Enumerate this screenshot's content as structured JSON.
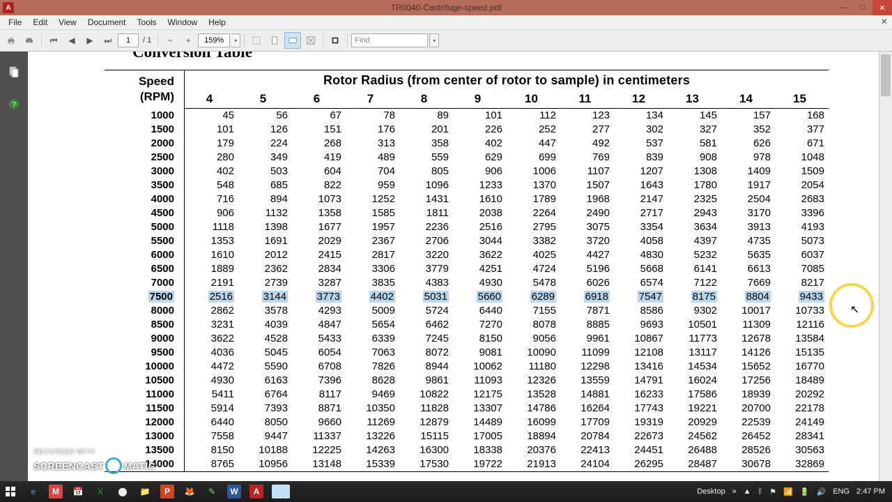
{
  "window": {
    "title": "TR0040-Centrifuge-speed.pdf",
    "app_glyph": "A"
  },
  "menu": [
    "File",
    "Edit",
    "View",
    "Document",
    "Tools",
    "Window",
    "Help"
  ],
  "toolbar": {
    "page_current": "1",
    "page_total": "/ 1",
    "zoom": "159%",
    "find_placeholder": "Find"
  },
  "doc": {
    "cut_title": "Conversion Table",
    "rpm_header_l1": "Speed",
    "rpm_header_l2": "(RPM)",
    "span_header": "Rotor Radius (from center of rotor to sample) in centimeters",
    "radius_headers": [
      "4",
      "5",
      "6",
      "7",
      "8",
      "9",
      "10",
      "11",
      "12",
      "13",
      "14",
      "15"
    ],
    "rows": [
      {
        "rpm": "1000",
        "v": [
          "45",
          "56",
          "67",
          "78",
          "89",
          "101",
          "112",
          "123",
          "134",
          "145",
          "157",
          "168"
        ]
      },
      {
        "rpm": "1500",
        "v": [
          "101",
          "126",
          "151",
          "176",
          "201",
          "226",
          "252",
          "277",
          "302",
          "327",
          "352",
          "377"
        ]
      },
      {
        "rpm": "2000",
        "v": [
          "179",
          "224",
          "268",
          "313",
          "358",
          "402",
          "447",
          "492",
          "537",
          "581",
          "626",
          "671"
        ]
      },
      {
        "rpm": "2500",
        "v": [
          "280",
          "349",
          "419",
          "489",
          "559",
          "629",
          "699",
          "769",
          "839",
          "908",
          "978",
          "1048"
        ]
      },
      {
        "rpm": "3000",
        "v": [
          "402",
          "503",
          "604",
          "704",
          "805",
          "906",
          "1006",
          "1107",
          "1207",
          "1308",
          "1409",
          "1509"
        ]
      },
      {
        "rpm": "3500",
        "v": [
          "548",
          "685",
          "822",
          "959",
          "1096",
          "1233",
          "1370",
          "1507",
          "1643",
          "1780",
          "1917",
          "2054"
        ]
      },
      {
        "rpm": "4000",
        "v": [
          "716",
          "894",
          "1073",
          "1252",
          "1431",
          "1610",
          "1789",
          "1968",
          "2147",
          "2325",
          "2504",
          "2683"
        ]
      },
      {
        "rpm": "4500",
        "v": [
          "906",
          "1132",
          "1358",
          "1585",
          "1811",
          "2038",
          "2264",
          "2490",
          "2717",
          "2943",
          "3170",
          "3396"
        ]
      },
      {
        "rpm": "5000",
        "v": [
          "1118",
          "1398",
          "1677",
          "1957",
          "2236",
          "2516",
          "2795",
          "3075",
          "3354",
          "3634",
          "3913",
          "4193"
        ]
      },
      {
        "rpm": "5500",
        "v": [
          "1353",
          "1691",
          "2029",
          "2367",
          "2706",
          "3044",
          "3382",
          "3720",
          "4058",
          "4397",
          "4735",
          "5073"
        ]
      },
      {
        "rpm": "6000",
        "v": [
          "1610",
          "2012",
          "2415",
          "2817",
          "3220",
          "3622",
          "4025",
          "4427",
          "4830",
          "5232",
          "5635",
          "6037"
        ]
      },
      {
        "rpm": "6500",
        "v": [
          "1889",
          "2362",
          "2834",
          "3306",
          "3779",
          "4251",
          "4724",
          "5196",
          "5668",
          "6141",
          "6613",
          "7085"
        ]
      },
      {
        "rpm": "7000",
        "v": [
          "2191",
          "2739",
          "3287",
          "3835",
          "4383",
          "4930",
          "5478",
          "6026",
          "6574",
          "7122",
          "7669",
          "8217"
        ]
      },
      {
        "rpm": "7500",
        "hl": true,
        "v": [
          "2516",
          "3144",
          "3773",
          "4402",
          "5031",
          "5660",
          "6289",
          "6918",
          "7547",
          "8175",
          "8804",
          "9433"
        ]
      },
      {
        "rpm": "8000",
        "v": [
          "2862",
          "3578",
          "4293",
          "5009",
          "5724",
          "6440",
          "7155",
          "7871",
          "8586",
          "9302",
          "10017",
          "10733"
        ]
      },
      {
        "rpm": "8500",
        "v": [
          "3231",
          "4039",
          "4847",
          "5654",
          "6462",
          "7270",
          "8078",
          "8885",
          "9693",
          "10501",
          "11309",
          "12116"
        ]
      },
      {
        "rpm": "9000",
        "v": [
          "3622",
          "4528",
          "5433",
          "6339",
          "7245",
          "8150",
          "9056",
          "9961",
          "10867",
          "11773",
          "12678",
          "13584"
        ]
      },
      {
        "rpm": "9500",
        "v": [
          "4036",
          "5045",
          "6054",
          "7063",
          "8072",
          "9081",
          "10090",
          "11099",
          "12108",
          "13117",
          "14126",
          "15135"
        ]
      },
      {
        "rpm": "10000",
        "v": [
          "4472",
          "5590",
          "6708",
          "7826",
          "8944",
          "10062",
          "11180",
          "12298",
          "13416",
          "14534",
          "15652",
          "16770"
        ]
      },
      {
        "rpm": "10500",
        "v": [
          "4930",
          "6163",
          "7396",
          "8628",
          "9861",
          "11093",
          "12326",
          "13559",
          "14791",
          "16024",
          "17256",
          "18489"
        ]
      },
      {
        "rpm": "11000",
        "v": [
          "5411",
          "6764",
          "8117",
          "9469",
          "10822",
          "12175",
          "13528",
          "14881",
          "16233",
          "17586",
          "18939",
          "20292"
        ]
      },
      {
        "rpm": "11500",
        "v": [
          "5914",
          "7393",
          "8871",
          "10350",
          "11828",
          "13307",
          "14786",
          "16264",
          "17743",
          "19221",
          "20700",
          "22178"
        ]
      },
      {
        "rpm": "12000",
        "v": [
          "6440",
          "8050",
          "9660",
          "11269",
          "12879",
          "14489",
          "16099",
          "17709",
          "19319",
          "20929",
          "22539",
          "24149"
        ]
      },
      {
        "rpm": "13000",
        "v": [
          "7558",
          "9447",
          "11337",
          "13226",
          "15115",
          "17005",
          "18894",
          "20784",
          "22673",
          "24562",
          "26452",
          "28341"
        ]
      },
      {
        "rpm": "13500",
        "v": [
          "8150",
          "10188",
          "12225",
          "14263",
          "16300",
          "18338",
          "20376",
          "22413",
          "24451",
          "26488",
          "28526",
          "30563"
        ]
      },
      {
        "rpm": "14000",
        "v": [
          "8765",
          "10956",
          "13148",
          "15339",
          "17530",
          "19722",
          "21913",
          "24104",
          "26295",
          "28487",
          "30678",
          "32869"
        ]
      }
    ]
  },
  "watermark": {
    "small": "RECORDED WITH",
    "big1": "SCREENCAST",
    "big2": "MATIC"
  },
  "taskbar": {
    "desktop_label": "Desktop",
    "lang": "ENG",
    "time": "2:47 PM",
    "date": "2:47 PM"
  }
}
